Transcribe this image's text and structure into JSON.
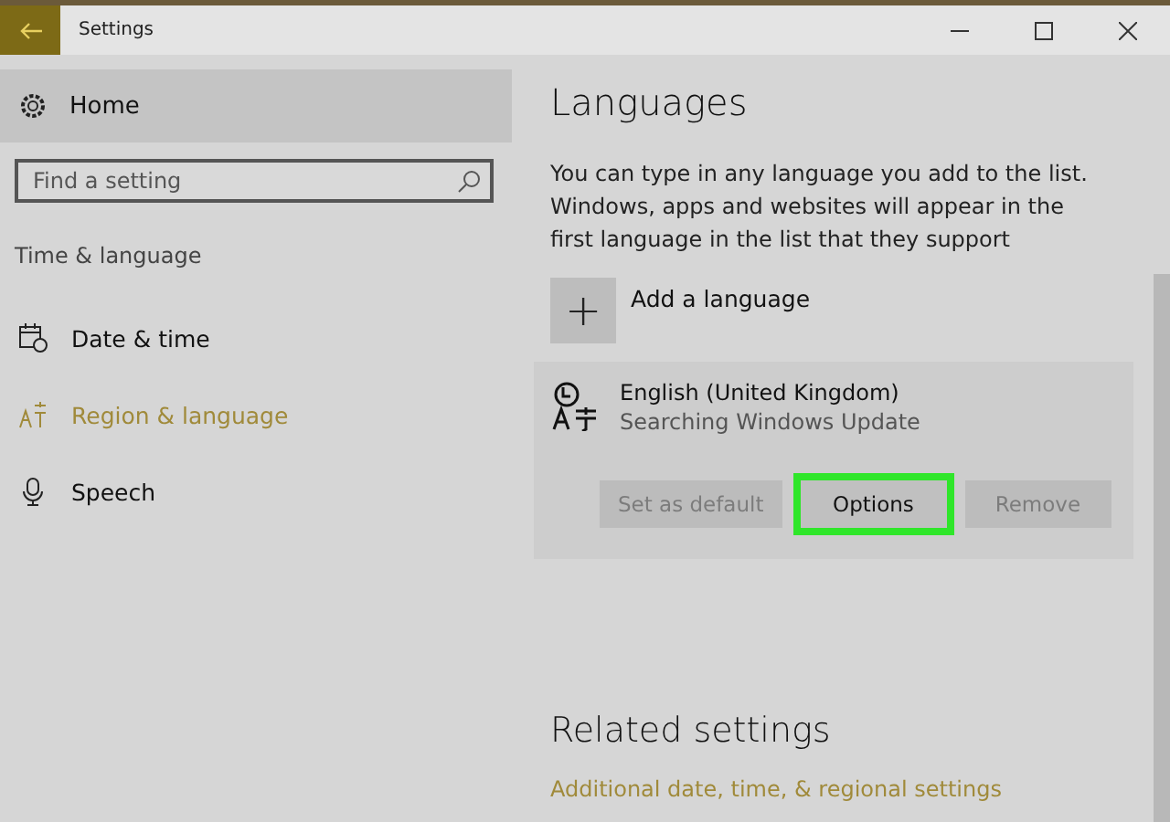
{
  "window": {
    "title": "Settings"
  },
  "sidebar": {
    "home": "Home",
    "search": {
      "placeholder": "Find a setting"
    },
    "section": "Time & language",
    "items": [
      {
        "label": "Date & time",
        "selected": false
      },
      {
        "label": "Region & language",
        "selected": true
      },
      {
        "label": "Speech",
        "selected": false
      }
    ]
  },
  "content": {
    "title": "Languages",
    "description": "You can type in any language you add to the list. Windows, apps and websites will appear in the first language in the list that they support",
    "add_language": {
      "icon": "+",
      "label": "Add a language"
    },
    "languages": [
      {
        "name": "English (United Kingdom)",
        "status": "Searching Windows Update",
        "buttons": [
          {
            "label": "Set as default",
            "disabled": true,
            "highlighted": false
          },
          {
            "label": "Options",
            "disabled": false,
            "highlighted": true
          },
          {
            "label": "Remove",
            "disabled": true,
            "highlighted": false
          }
        ]
      }
    ],
    "related_title": "Related settings",
    "related_link": "Additional date, time, & regional settings"
  }
}
